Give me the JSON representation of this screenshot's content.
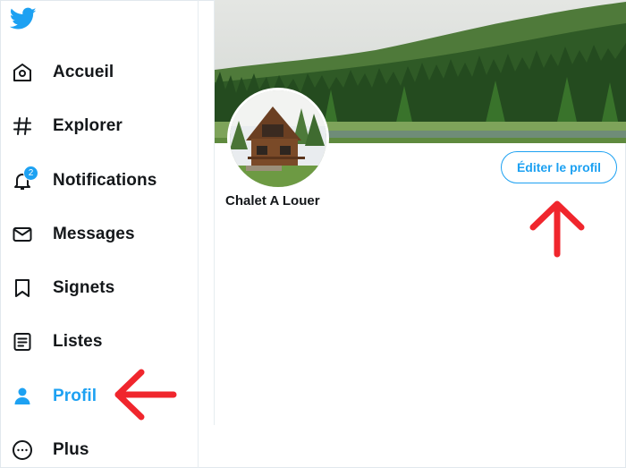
{
  "colors": {
    "accent": "#1da1f2",
    "text": "#14171a",
    "arrow": "#f0262d"
  },
  "sidebar": {
    "logo_icon": "twitter-bird-icon",
    "items": [
      {
        "label": "Accueil",
        "icon": "home-icon"
      },
      {
        "label": "Explorer",
        "icon": "hashtag-icon"
      },
      {
        "label": "Notifications",
        "icon": "bell-icon",
        "badge": "2"
      },
      {
        "label": "Messages",
        "icon": "envelope-icon"
      },
      {
        "label": "Signets",
        "icon": "bookmark-icon"
      },
      {
        "label": "Listes",
        "icon": "list-icon"
      },
      {
        "label": "Profil",
        "icon": "person-icon",
        "active": true
      },
      {
        "label": "Plus",
        "icon": "more-icon"
      }
    ]
  },
  "profile": {
    "display_name": "Chalet A Louer",
    "edit_button_label": "Éditer le profil"
  }
}
